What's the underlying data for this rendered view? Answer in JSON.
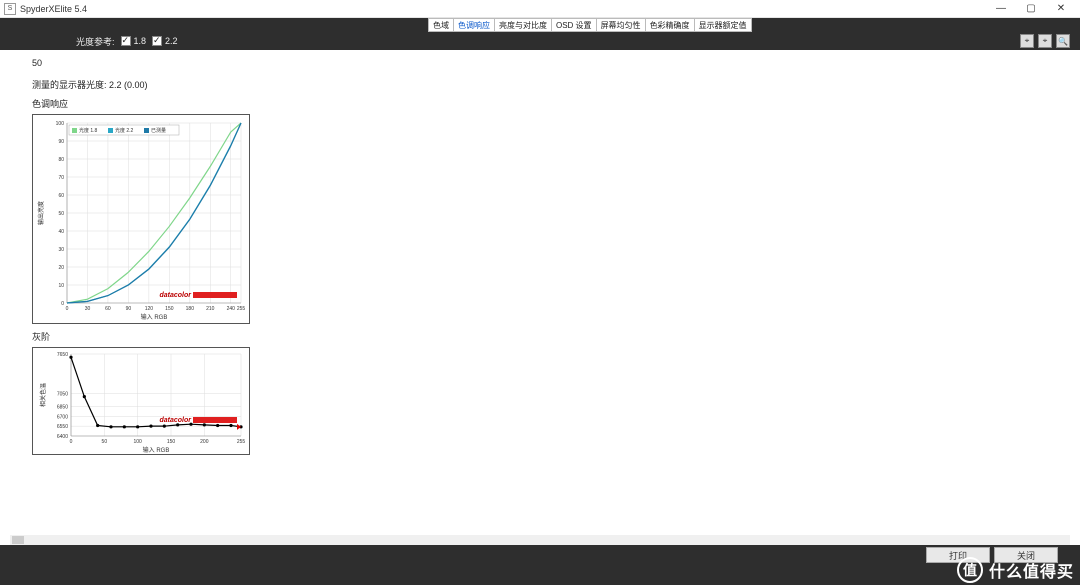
{
  "window": {
    "title": "SpyderXElite 5.4",
    "icon_glyph": "S",
    "min": "—",
    "max": "▢",
    "close": "✕"
  },
  "tabs": [
    {
      "label": "色域",
      "active": false
    },
    {
      "label": "色调响应",
      "active": true
    },
    {
      "label": "亮度与对比度",
      "active": false
    },
    {
      "label": "OSD 设置",
      "active": false
    },
    {
      "label": "屏幕均匀性",
      "active": false
    },
    {
      "label": "色彩精确度",
      "active": false
    },
    {
      "label": "显示器额定值",
      "active": false
    }
  ],
  "toolbar": {
    "ref_label": "光度参考:",
    "opt1": {
      "checked": true,
      "label": "1.8"
    },
    "opt2": {
      "checked": true,
      "label": "2.2"
    },
    "icons": [
      "⌖",
      "⌖",
      "🔍"
    ]
  },
  "content": {
    "top_value": "50",
    "measure_line": "测量的显示器光度:  2.2 (0.00)",
    "chart1_title": "色调响应",
    "chart2_title": "灰阶"
  },
  "chart_data": [
    {
      "type": "line",
      "title": "色调响应",
      "xlabel": "输入 RGB",
      "ylabel": "输出亮度",
      "xlim": [
        0,
        255
      ],
      "ylim": [
        0,
        100
      ],
      "xticks": [
        0,
        30,
        60,
        90,
        120,
        150,
        180,
        210,
        240,
        255
      ],
      "yticks": [
        0,
        10,
        20,
        30,
        40,
        50,
        60,
        70,
        80,
        90,
        100
      ],
      "legend": [
        "光度 1.8",
        "光度 2.2",
        "已测量"
      ],
      "series": [
        {
          "name": "光度 1.8",
          "color": "#7fd68a",
          "x": [
            0,
            30,
            60,
            90,
            120,
            150,
            180,
            210,
            240,
            255
          ],
          "y": [
            0,
            2.1,
            8.0,
            17.1,
            28.7,
            42.6,
            58.4,
            75.9,
            95.0,
            100
          ]
        },
        {
          "name": "光度 2.2",
          "color": "#2aa8c7",
          "x": [
            0,
            30,
            60,
            90,
            120,
            150,
            180,
            210,
            240,
            255
          ],
          "y": [
            0,
            0.9,
            4.1,
            10.1,
            19.0,
            31.2,
            46.7,
            65.5,
            87.6,
            100
          ]
        },
        {
          "name": "已测量",
          "color": "#1f7aa8",
          "x": [
            0,
            30,
            60,
            90,
            120,
            150,
            180,
            210,
            240,
            255
          ],
          "y": [
            0,
            0.9,
            4.1,
            10.0,
            18.8,
            31.0,
            46.5,
            65.2,
            87.3,
            100
          ]
        }
      ],
      "brand": "datacolor"
    },
    {
      "type": "line",
      "title": "灰阶",
      "xlabel": "输入 RGB",
      "ylabel": "相关色温",
      "xlim": [
        0,
        255
      ],
      "ylim": [
        6400,
        7650
      ],
      "xticks": [
        0,
        50,
        100,
        150,
        200,
        255
      ],
      "yticks": [
        6400,
        6550,
        6700,
        6850,
        7050,
        7650
      ],
      "series": [
        {
          "name": "灰阶",
          "color": "#000",
          "points": true,
          "x": [
            0,
            20,
            40,
            60,
            80,
            100,
            120,
            140,
            160,
            180,
            200,
            220,
            240,
            255
          ],
          "y": [
            7600,
            7000,
            6560,
            6540,
            6540,
            6540,
            6550,
            6550,
            6570,
            6580,
            6570,
            6560,
            6560,
            6540
          ]
        }
      ],
      "brand": "datacolor"
    }
  ],
  "footer": {
    "btn_print": "打印",
    "btn_close": "关闭"
  },
  "watermark": {
    "circle": "值",
    "text": "什么值得买"
  }
}
